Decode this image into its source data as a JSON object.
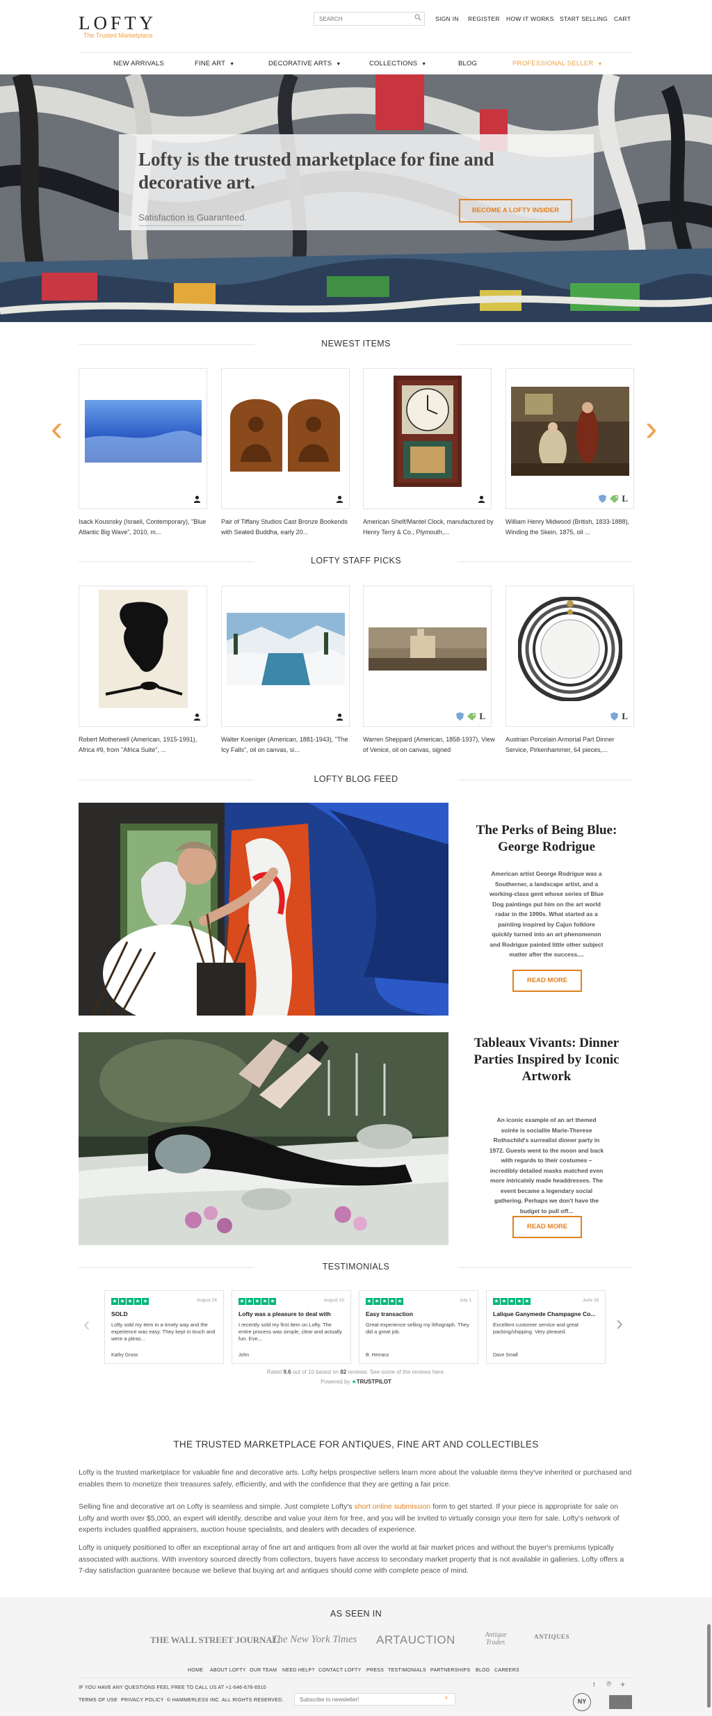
{
  "header": {
    "logo": "LOFTY",
    "tagline": "The Trusted Marketplace",
    "search_placeholder": "SEARCH",
    "top_links": [
      "SIGN IN",
      "REGISTER",
      "HOW IT WORKS",
      "START SELLING",
      "CART"
    ]
  },
  "nav": {
    "items": [
      {
        "label": "NEW ARRIVALS"
      },
      {
        "label": "FINE ART"
      },
      {
        "label": "DECORATIVE ARTS"
      },
      {
        "label": "COLLECTIONS"
      },
      {
        "label": "BLOG"
      },
      {
        "label": "PROFESSIONAL SELLER"
      }
    ],
    "highlight_color": "#f0a040"
  },
  "hero": {
    "title": "Lofty is the trusted marketplace for fine and decorative art.",
    "subtitle": "Satisfaction is Guaranteed.",
    "cta": "BECOME A LOFTY INSIDER"
  },
  "newest": {
    "heading": "NEWEST ITEMS",
    "items": [
      {
        "caption": "Isack Kousnsky (Israeli, Contemporary), \"Blue Atlantic Big Wave\", 2010, m..."
      },
      {
        "caption": "Pair of Tiffany Studios Cast Bronze Bookends with Seated Buddha, early 20..."
      },
      {
        "caption": "American Shelf/Mantel Clock, manufactured by Henry Terry & Co., Plymouth,..."
      },
      {
        "caption": "William Henry Midwood (British, 1833-1888), Winding the Skein, 1875, oil ..."
      }
    ]
  },
  "staff": {
    "heading": "LOFTY STAFF PICKS",
    "items": [
      {
        "caption": "Robert Motherwell (American, 1915-1991), Africa #9, from \"Africa Suite\", ..."
      },
      {
        "caption": "Walter Koeniger (American, 1881-1943), \"The Icy Falls\", oil on canvas, si..."
      },
      {
        "caption": "Warren Sheppard (American, 1858-1937), View of Venice, oil on canvas, signed"
      },
      {
        "caption": "Austrian Porcelain Armorial Part Dinner Service, Pirkenhammer, 64 pieces,..."
      }
    ]
  },
  "blog": {
    "heading": "LOFTY BLOG FEED",
    "posts": [
      {
        "title": "The Perks of Being Blue: George Rodrigue",
        "excerpt": "American artist George Rodrigue was a Southerner, a landscape artist, and a working-class gent whose series of Blue Dog paintings put him on the art world radar in the 1990s. What started as a painting inspired by Cajun folklore quickly turned into an art phenomenon and Rodrigue painted little other subject matter after the success....",
        "cta": "READ MORE"
      },
      {
        "title": "Tableaux Vivants: Dinner Parties Inspired by Iconic Artwork",
        "excerpt": "An iconic example of an art themed soirée is socialite Marie-Therese Rothschild's surrealist dinner party in 1972. Guests went to the moon and back with regards to their costumes – incredibly detailed masks matched even more intricately made headdresses. The event became a legendary social gathering. Perhaps we don't have the budget to pull off...",
        "cta": "READ MORE"
      }
    ]
  },
  "testimonials": {
    "heading": "TESTIMONIALS",
    "reviews": [
      {
        "date": "August 28",
        "title": "SOLD",
        "body": "Lofty sold my item in a timely way and the experience was easy. They kept in touch and were a pleas...",
        "author": "Kathy Gross"
      },
      {
        "date": "August 10",
        "title": "Lofty was a pleasure to deal with",
        "body": "I recently sold my first item on Lofty. The entire process was simple, clear and actually fun. Eve...",
        "author": "John"
      },
      {
        "date": "July 1",
        "title": "Easy transaction",
        "body": "Great experience selling my lithograph. They did a great job.",
        "author": "B. Herranz"
      },
      {
        "date": "June 29",
        "title": "Lalique Ganymede Champagne Co...",
        "body": "Excellent customer service and great packing/shipping. Very pleased.",
        "author": "Dave Small"
      }
    ],
    "rating_prefix": "Rated ",
    "rating": "9.6",
    "rating_mid": " out of 10 based on ",
    "review_count": "82",
    "rating_suffix": " reviews. See some of the reviews here.",
    "powered": "Powered by",
    "trustpilot": "TRUSTPILOT",
    "star_color": "#00b67a"
  },
  "about": {
    "heading": "THE TRUSTED MARKETPLACE FOR ANTIQUES, FINE ART AND COLLECTIBLES",
    "p1": "Lofty is the trusted marketplace for valuable fine and decorative arts. Lofty helps prospective sellers learn more about the valuable items they've inherited or purchased and enables them to monetize their treasures safely, efficiently, and with the confidence that they are getting a fair price.",
    "p2_before": "Selling fine and decorative art on Lofty is seamless and simple. Just complete Lofty's ",
    "p2_link": "short online submission",
    "p2_after": " form to get started. If your piece is appropriate for sale on Lofty and worth over $5,000, an expert will identify, describe and value your item for free, and you will be invited to virtually consign your item for sale. Lofty's network of experts includes qualified appraisers, auction house specialists, and dealers with decades of experience.",
    "p3": "Lofty is uniquely positioned to offer an exceptional array of fine art and antiques from all over the world at fair market prices and without the buyer's premiums typically associated with auctions. With inventory sourced directly from collectors, buyers have access to secondary market property that is not available in galleries. Lofty offers a 7-day satisfaction guarantee because we believe that buying art and antiques should come with complete peace of mind."
  },
  "footer": {
    "heading": "AS SEEN IN",
    "press": [
      "THE WALL STREET JOURNAL.",
      "The New York Times",
      "ARTAUCTION",
      "Antique Trader.",
      "ANTIQUES"
    ],
    "links": [
      "HOME",
      "ABOUT LOFTY",
      "OUR TEAM",
      "NEED HELP?",
      "CONTACT LOFTY",
      "PRESS",
      "TESTIMONIALS",
      "PARTNERSHIPS",
      "BLOG",
      "CAREERS"
    ],
    "contact": "IF YOU HAVE ANY QUESTIONS FEEL FREE TO CALL US AT +1-646-678-6510",
    "legal": [
      "TERMS OF USE",
      "PRIVACY POLICY",
      "© HAMMERLESS INC. ALL RIGHTS RESERVED."
    ],
    "newsletter_placeholder": "Subscribe to newsletter!",
    "badge_ny": "NY"
  },
  "colors": {
    "accent": "#e2801e",
    "text": "#333333"
  }
}
